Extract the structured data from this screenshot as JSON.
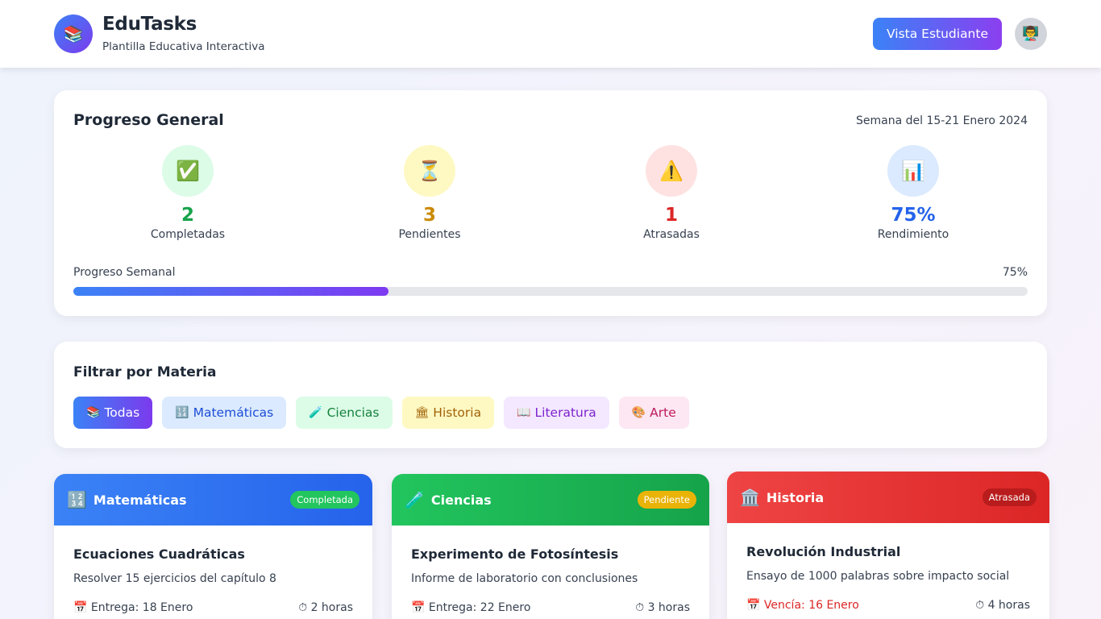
{
  "header": {
    "logo_icon": "books-icon",
    "title": "EduTasks",
    "subtitle": "Plantilla Educativa Interactiva",
    "view_button": "Vista Estudiante",
    "avatar_icon": "teacher-avatar-icon"
  },
  "progress": {
    "title": "Progreso General",
    "week": "Semana del 15-21 Enero 2024",
    "stats": [
      {
        "icon": "✅",
        "value": "2",
        "label": "Completadas",
        "color": "#16a34a",
        "bg": "#dcfce7"
      },
      {
        "icon": "⏳",
        "value": "3",
        "label": "Pendientes",
        "color": "#ca8a04",
        "bg": "#fef9c3"
      },
      {
        "icon": "⚠️",
        "value": "1",
        "label": "Atrasadas",
        "color": "#dc2626",
        "bg": "#fee2e2"
      },
      {
        "icon": "📊",
        "value": "75%",
        "label": "Rendimiento",
        "color": "#2563eb",
        "bg": "#dbeafe"
      }
    ],
    "weekly_label": "Progreso Semanal",
    "weekly_value": "75%",
    "weekly_fill_fraction": 0.33
  },
  "filter": {
    "title": "Filtrar por Materia",
    "chips": [
      {
        "icon": "📚",
        "label": "Todas",
        "bg": "linear-gradient(90deg,#3b82f6,#7c3aed)",
        "color": "#ffffff"
      },
      {
        "icon": "🔢",
        "label": "Matemáticas",
        "bg": "#dbeafe",
        "color": "#1d4ed8"
      },
      {
        "icon": "🧪",
        "label": "Ciencias",
        "bg": "#dcfce7",
        "color": "#15803d"
      },
      {
        "icon": "🏛",
        "label": "Historia",
        "bg": "#fef9c3",
        "color": "#a16207"
      },
      {
        "icon": "📖",
        "label": "Literatura",
        "bg": "#f3e8ff",
        "color": "#7e22ce"
      },
      {
        "icon": "🎨",
        "label": "Arte",
        "bg": "#fce7f3",
        "color": "#be185d"
      }
    ]
  },
  "tasks": [
    {
      "subject_icon": "🔢",
      "subject": "Matemáticas",
      "status": "Completada",
      "head_bg": "linear-gradient(90deg,#3b82f6,#2563eb)",
      "badge_bg": "#22c55e",
      "badge_color": "#ffffff",
      "title": "Ecuaciones Cuadráticas",
      "desc": "Resolver 15 ejercicios del capítulo 8",
      "due": "📅 Entrega: 18 Enero",
      "due_color": "#374151",
      "time": "⏱ 2 horas"
    },
    {
      "subject_icon": "🧪",
      "subject": "Ciencias",
      "status": "Pendiente",
      "head_bg": "linear-gradient(90deg,#22c55e,#16a34a)",
      "badge_bg": "#eab308",
      "badge_color": "#ffffff",
      "title": "Experimento de Fotosíntesis",
      "desc": "Informe de laboratorio con conclusiones",
      "due": "📅 Entrega: 22 Enero",
      "due_color": "#374151",
      "time": "⏱ 3 horas"
    },
    {
      "subject_icon": "🏛️",
      "subject": "Historia",
      "status": "Atrasada",
      "head_bg": "linear-gradient(90deg,#ef4444,#dc2626)",
      "badge_bg": "#b91c1c",
      "badge_color": "#ffffff",
      "title": "Revolución Industrial",
      "desc": "Ensayo de 1000 palabras sobre impacto social",
      "due": "📅 Vencía: 16 Enero",
      "due_color": "#dc2626",
      "time": "⏱ 4 horas"
    }
  ]
}
